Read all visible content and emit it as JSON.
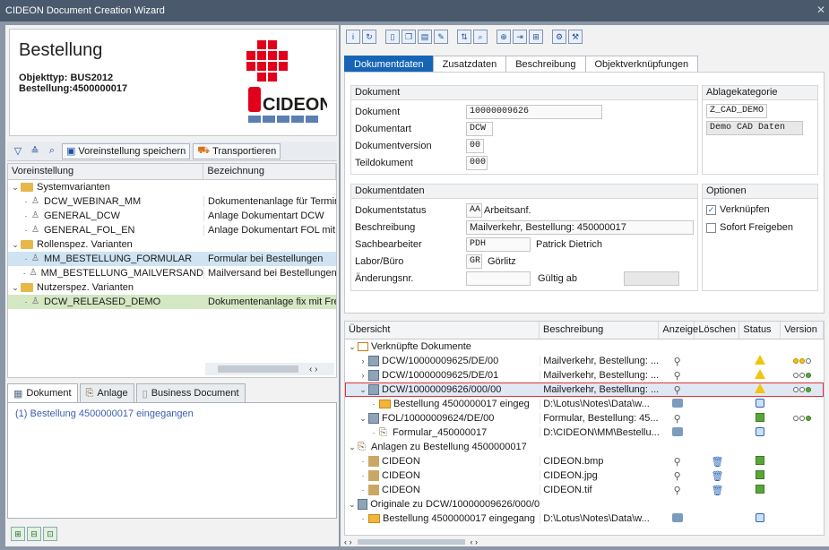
{
  "window": {
    "title": "CIDEON Document Creation Wizard"
  },
  "header": {
    "title": "Bestellung",
    "objekttyp_label": "Objekttyp:",
    "objekttyp_value": "BUS2012",
    "bestellung_label": "Bestellung:",
    "bestellung_value": "4500000017",
    "logo_text": "CIDEON"
  },
  "left_toolbar": {
    "save_default_label": "Voreinstellung speichern",
    "transport_label": "Transportieren"
  },
  "variants": {
    "columns": [
      "Voreinstellung",
      "Bezeichnung"
    ],
    "rows": [
      {
        "level": 0,
        "type": "folder",
        "name": "Systemvarianten",
        "desc": ""
      },
      {
        "level": 1,
        "type": "user",
        "name": "DCW_WEBINAR_MM",
        "desc": "Dokumentenanlage für Termina"
      },
      {
        "level": 1,
        "type": "user",
        "name": "GENERAL_DCW",
        "desc": "Anlage Dokumentart DCW"
      },
      {
        "level": 1,
        "type": "user",
        "name": "GENERAL_FOL_EN",
        "desc": "Anlage Dokumentart FOL mit El"
      },
      {
        "level": 0,
        "type": "folder",
        "name": "Rollenspez. Varianten",
        "desc": ""
      },
      {
        "level": 1,
        "type": "user",
        "name": "MM_BESTELLUNG_FORMULAR",
        "desc": "Formular bei Bestellungen",
        "sel": "blue"
      },
      {
        "level": 1,
        "type": "user",
        "name": "MM_BESTELLUNG_MAILVERSAND",
        "desc": "Mailversand bei Bestellungen"
      },
      {
        "level": 0,
        "type": "folder",
        "name": "Nutzerspez. Varianten",
        "desc": ""
      },
      {
        "level": 1,
        "type": "user",
        "name": "DCW_RELEASED_DEMO",
        "desc": "Dokumentenanlage fix mit Freig",
        "sel": "green"
      }
    ]
  },
  "left_tabs": {
    "document": "Dokument",
    "attachment": "Anlage",
    "business": "Business Document"
  },
  "messages": [
    "(1) Bestellung 4500000017 eingegangen"
  ],
  "tabs": [
    "Dokumentdaten",
    "Zusatzdaten",
    "Beschreibung",
    "Objektverknüpfungen"
  ],
  "dokument": {
    "title": "Dokument",
    "dokument_label": "Dokument",
    "dokument_value": "10000009626",
    "art_label": "Dokumentart",
    "art_value": "DCW",
    "version_label": "Dokumentversion",
    "version_value": "00",
    "teil_label": "Teildokument",
    "teil_value": "000"
  },
  "ablage": {
    "title": "Ablagekategorie",
    "code": "Z_CAD_DEMO",
    "desc": "Demo CAD Daten"
  },
  "dokumentdaten": {
    "title": "Dokumentdaten",
    "status_label": "Dokumentstatus",
    "status_code": "AA",
    "status_text": "Arbeitsanf.",
    "beschreibung_label": "Beschreibung",
    "beschreibung_value": "Mailverkehr, Bestellung: 450000017",
    "sachbearbeiter_label": "Sachbearbeiter",
    "sachbearbeiter_code": "PDH",
    "sachbearbeiter_name": "Patrick Dietrich",
    "labor_label": "Labor/Büro",
    "labor_code": "GR",
    "labor_name": "Görlitz",
    "aenderung_label": "Änderungsnr.",
    "aenderung_value": "",
    "gueltig_label": "Gültig ab",
    "gueltig_value": ""
  },
  "optionen": {
    "title": "Optionen",
    "verknuepfen": "Verknüpfen",
    "verknuepfen_checked": true,
    "freigeben": "Sofort Freigeben",
    "freigeben_checked": false
  },
  "overview": {
    "columns": [
      "Übersicht",
      "Beschreibung",
      "Anzeige",
      "Löschen",
      "Status",
      "Version"
    ],
    "rows": [
      {
        "lvl": 0,
        "tw": "v",
        "icon": "link",
        "name": "Verknüpfte Dokumente",
        "desc": "",
        "anzeige": "",
        "loeschen": "",
        "status": "",
        "version": ""
      },
      {
        "lvl": 1,
        "tw": ">",
        "icon": "doc",
        "name": "DCW/10000009625/DE/00",
        "desc": "Mailverkehr, Bestellung: ...",
        "anzeige": "glasses",
        "loeschen": "",
        "status": "triangle",
        "version": "yyw"
      },
      {
        "lvl": 1,
        "tw": ">",
        "icon": "doc",
        "name": "DCW/10000009625/DE/01",
        "desc": "Mailverkehr, Bestellung: ...",
        "anzeige": "glasses",
        "loeschen": "",
        "status": "triangle",
        "version": "wwg"
      },
      {
        "lvl": 1,
        "tw": "v",
        "icon": "doc",
        "name": "DCW/10000009626/000/00",
        "desc": "Mailverkehr, Bestellung: ...",
        "anzeige": "glasses",
        "loeschen": "",
        "status": "triangle",
        "version": "wwg",
        "sel": true
      },
      {
        "lvl": 2,
        "tw": "",
        "icon": "mail",
        "name": "Bestellung 4500000017 eingeg",
        "desc": "D:\\Lotus\\Notes\\Data\\w...",
        "anzeige": "roll",
        "loeschen": "",
        "status": "lock",
        "version": ""
      },
      {
        "lvl": 1,
        "tw": "v",
        "icon": "doc",
        "name": "FOL/10000009624/DE/00",
        "desc": "Formular, Bestellung: 45...",
        "anzeige": "glasses",
        "loeschen": "",
        "status": "square",
        "version": "wwg"
      },
      {
        "lvl": 2,
        "tw": "",
        "icon": "attach",
        "name": "Formular_450000017",
        "desc": "D:\\CIDEON\\MM\\Bestellu...",
        "anzeige": "roll",
        "loeschen": "",
        "status": "lock",
        "version": ""
      },
      {
        "lvl": 0,
        "tw": "v",
        "icon": "attach-folder",
        "name": "Anlagen zu Bestellung 4500000017",
        "desc": "",
        "anzeige": "",
        "loeschen": "",
        "status": "",
        "version": ""
      },
      {
        "lvl": 1,
        "tw": "",
        "icon": "image",
        "name": "CIDEON",
        "desc": "CIDEON.bmp",
        "anzeige": "glasses",
        "loeschen": "trash",
        "status": "square",
        "version": ""
      },
      {
        "lvl": 1,
        "tw": "",
        "icon": "image",
        "name": "CIDEON",
        "desc": "CIDEON.jpg",
        "anzeige": "glasses",
        "loeschen": "trash",
        "status": "square",
        "version": ""
      },
      {
        "lvl": 1,
        "tw": "",
        "icon": "image",
        "name": "CIDEON",
        "desc": "CIDEON.tif",
        "anzeige": "glasses",
        "loeschen": "trash",
        "status": "square",
        "version": ""
      },
      {
        "lvl": 0,
        "tw": "v",
        "icon": "doc",
        "name": "Originale zu DCW/10000009626/000/0",
        "desc": "",
        "anzeige": "",
        "loeschen": "",
        "status": "",
        "version": ""
      },
      {
        "lvl": 1,
        "tw": "",
        "icon": "mail",
        "name": "Bestellung 4500000017 eingegang",
        "desc": "D:\\Lotus\\Notes\\Data\\w...",
        "anzeige": "roll",
        "loeschen": "",
        "status": "lock",
        "version": ""
      }
    ]
  }
}
